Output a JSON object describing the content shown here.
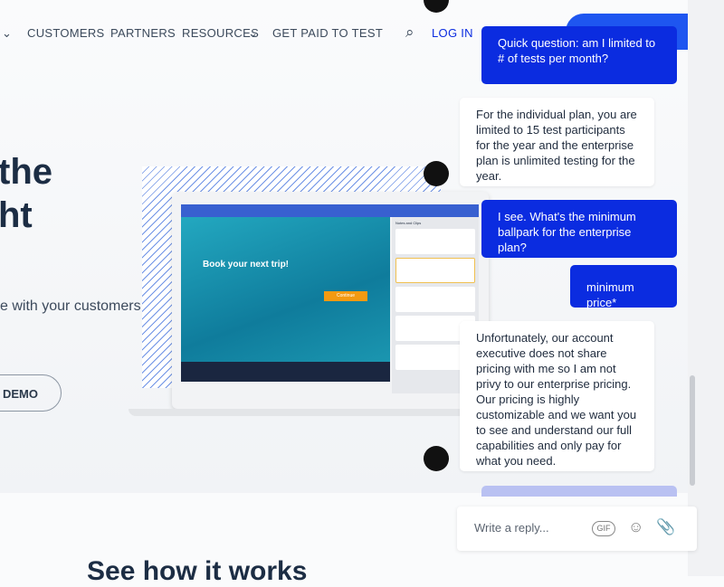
{
  "nav": {
    "items": [
      "CUSTOMERS",
      "PARTNERS",
      "RESOURCES",
      "GET PAID TO TEST"
    ],
    "login": "LOG IN"
  },
  "hero": {
    "line1": "the",
    "line2": "ht",
    "subtitle": "e with your customers",
    "demo": "DEMO"
  },
  "mockup": {
    "headline": "Book your next trip!",
    "continue": "Continue",
    "notes_title": "Notes and Clips"
  },
  "chat": {
    "messages": [
      {
        "from": "user",
        "text": "Quick question: am I limited to # of tests per month?"
      },
      {
        "from": "agent",
        "text": "For the individual plan, you are limited to 15 test participants for the year and the enterprise plan is unlimited testing for the year."
      },
      {
        "from": "user",
        "text": "I see. What's the minimum ballpark for the enterprise plan?"
      },
      {
        "from": "user",
        "text": "minimum  price*"
      },
      {
        "from": "agent",
        "text": "Unfortunately, our account executive does not share pricing with me so I am not privy to our enterprise pricing. Our pricing is highly customizable and we want you to see and understand our full capabilities and only pay for what you need."
      }
    ],
    "reply_placeholder": "Write a reply...",
    "gif": "GIF"
  },
  "section": {
    "title": "See how it works"
  },
  "colors": {
    "accent": "#0b2ce0"
  }
}
